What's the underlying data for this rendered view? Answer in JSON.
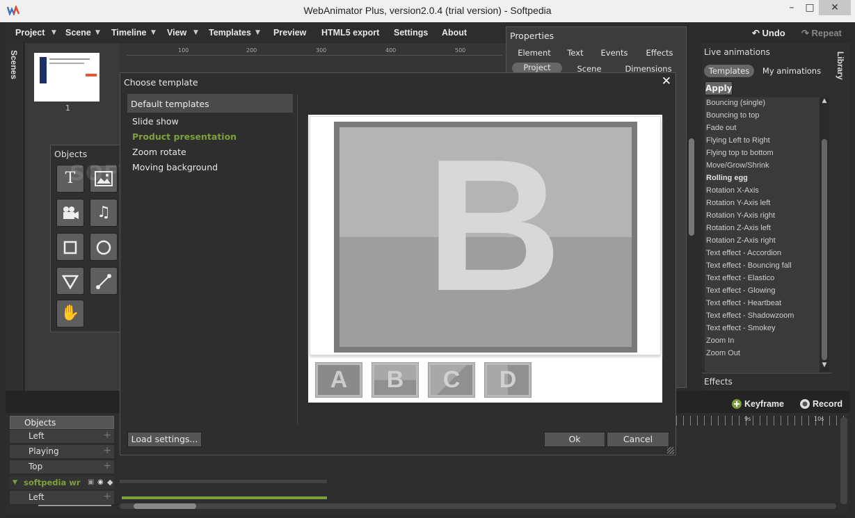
{
  "window": {
    "title": "WebAnimator Plus, version2.0.4 (trial version) - Softpedia",
    "logo_text": "WA",
    "min_glyph": "–",
    "max_glyph": "□",
    "close_glyph": "✕"
  },
  "menu": [
    {
      "label": "Project",
      "dropdown": true
    },
    {
      "label": "Scene",
      "dropdown": true
    },
    {
      "label": "Timeline",
      "dropdown": true
    },
    {
      "label": "View",
      "dropdown": true
    },
    {
      "label": "Templates",
      "dropdown": true
    },
    {
      "label": "Preview",
      "dropdown": false
    },
    {
      "label": "HTML5 export",
      "dropdown": false
    },
    {
      "label": "Settings",
      "dropdown": false
    },
    {
      "label": "About",
      "dropdown": false
    }
  ],
  "toolbar": {
    "undo": "Undo",
    "redo": "Repeat",
    "undo_icon": "↶",
    "redo_icon": "↷"
  },
  "scenes": {
    "label": "Scenes",
    "thumb_number": "1"
  },
  "ruler_ticks": [
    "100",
    "200",
    "300",
    "400",
    "500"
  ],
  "objects_panel": {
    "title": "Objects",
    "tools": [
      "text-tool",
      "image-tool",
      "video-tool",
      "audio-tool",
      "rectangle-tool",
      "circle-tool",
      "triangle-tool",
      "line-tool",
      "hand-tool"
    ]
  },
  "properties": {
    "title": "Properties",
    "tabs_row1": [
      "Element",
      "Text",
      "Events",
      "Effects"
    ],
    "tabs_row2": [
      "Project",
      "Scene",
      "Dimensions"
    ],
    "active_tab": "Project"
  },
  "live_animations": {
    "title": "Live animations",
    "tabs": [
      "Templates",
      "My animations"
    ],
    "apply_label": "Apply",
    "items": [
      "Bouncing (single)",
      "Bouncing to top",
      "Fade out",
      "Flying Left to Right",
      "Flying top to bottom",
      "Move/Grow/Shrink",
      "Rolling egg",
      "Rotation X-Axis",
      "Rotation Y-Axis left",
      "Rotation Y-Axis right",
      "Rotation Z-Axis left",
      "Rotation Z-Axis right",
      "Text effect - Accordion",
      "Text effect - Bouncing fall",
      "Text effect - Elastico",
      "Text effect - Glowing",
      "Text effect - Heartbeat",
      "Text effect - Shadowzoom",
      "Text effect - Smokey",
      "Zoom In",
      "Zoom Out"
    ],
    "selected": "Rolling egg"
  },
  "library": {
    "label": "Library"
  },
  "effects": {
    "label": "Effects"
  },
  "timeline": {
    "keyframe": "Keyframe",
    "record": "Record",
    "objects_header": "Objects",
    "rows": [
      "Left",
      "Playing",
      "Top"
    ],
    "layer_name": "softpedia wr",
    "layer_row": "Left",
    "ticks": [
      "9s",
      "10s"
    ]
  },
  "dialog": {
    "title": "Choose template",
    "list_header": "Default templates",
    "templates": [
      "Slide show",
      "Product presentation",
      "Zoom rotate",
      "Moving background"
    ],
    "selected": "Product presentation",
    "preview_big_letter": "B",
    "preview_thumbs": [
      "A",
      "B",
      "C",
      "D"
    ],
    "load_settings": "Load settings...",
    "ok": "Ok",
    "cancel": "Cancel"
  },
  "watermark": "SOFTPEDIA",
  "colors": {
    "accent_green": "#7da13a",
    "record_red": "#e35a2e"
  }
}
